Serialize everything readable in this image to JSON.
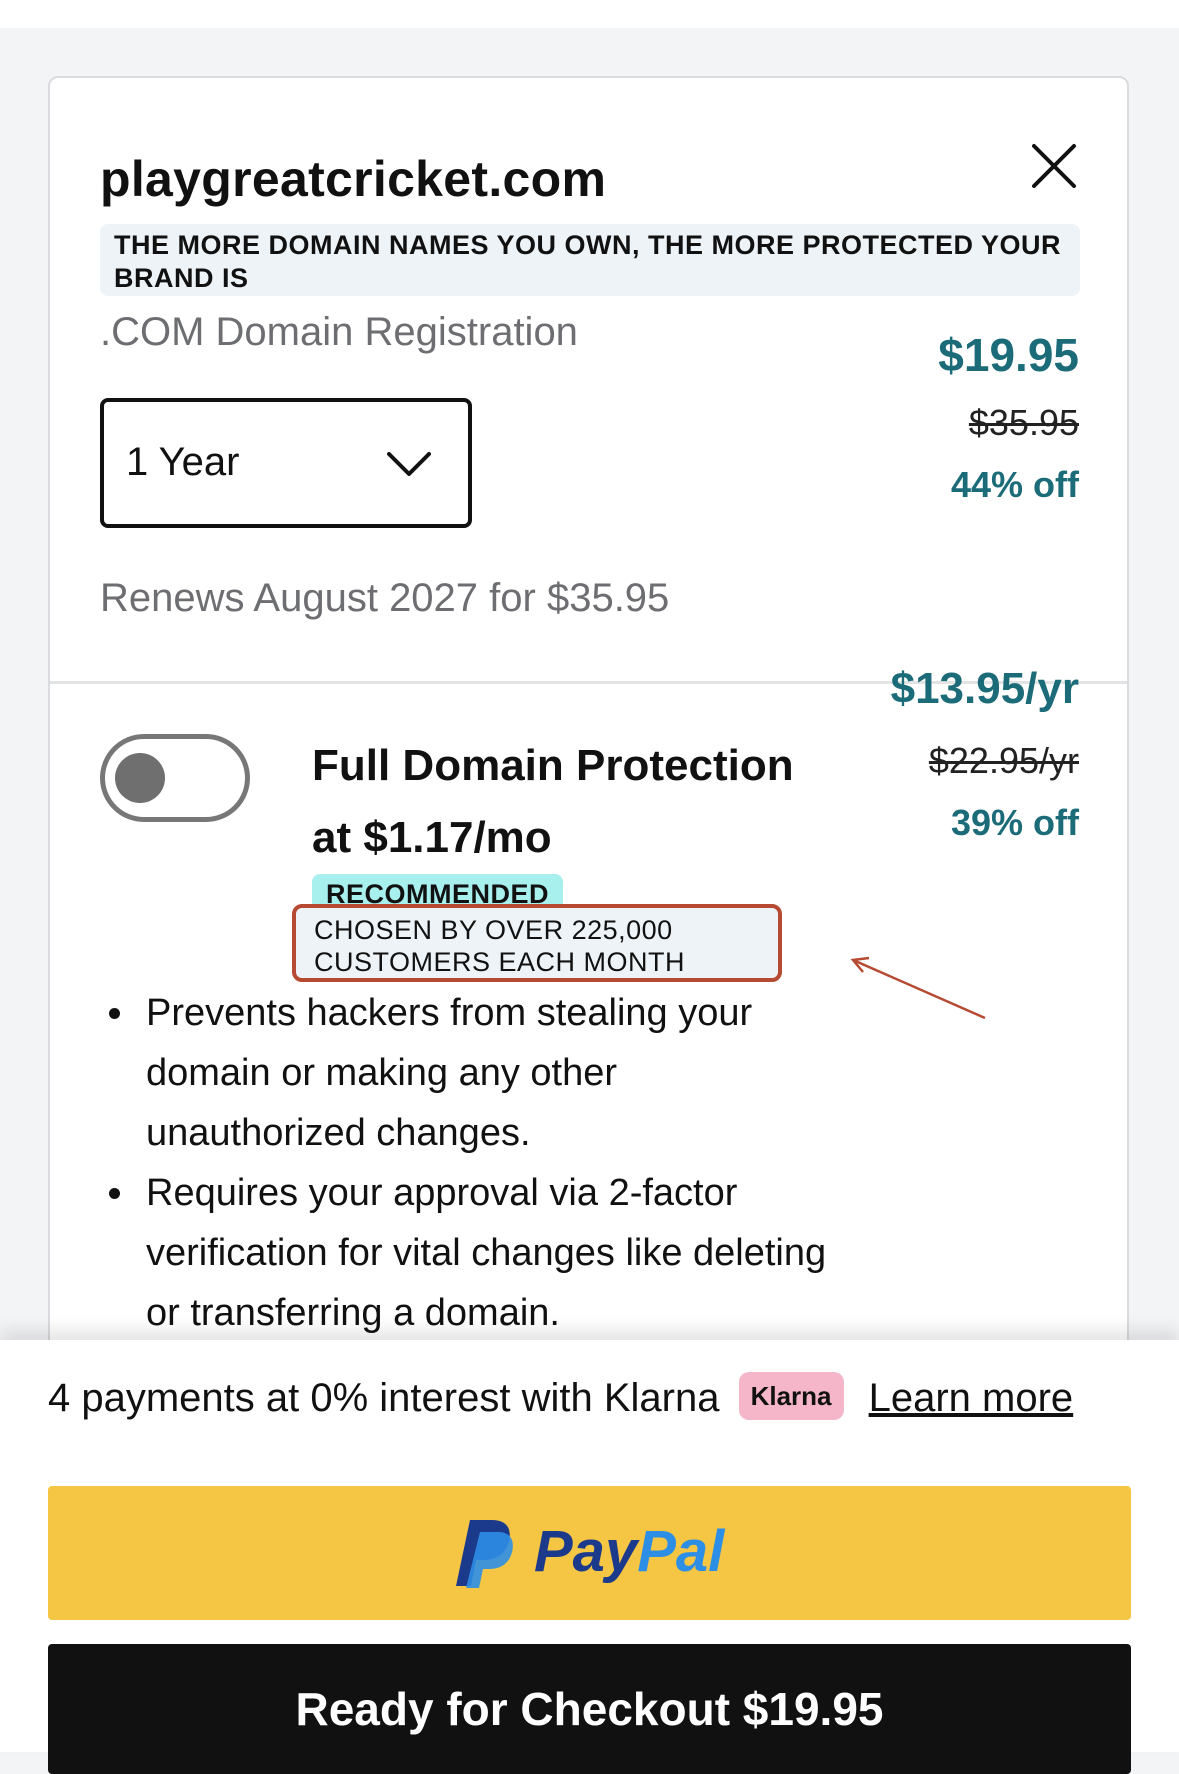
{
  "domain": {
    "name": "playgreatcricket.com",
    "promo": "THE MORE DOMAIN NAMES YOU OWN, THE MORE PROTECTED YOUR BRAND IS",
    "product_label": ".COM Domain Registration",
    "term_select": {
      "value": "1 Year",
      "options": [
        "1 Year"
      ]
    },
    "price": "$19.95",
    "original_price": "$35.95",
    "discount": "44% off",
    "renewal": "Renews August 2027 for $35.95"
  },
  "protection": {
    "toggle_on": false,
    "title_line1": "Full Domain Protection",
    "title_line2": "at $1.17/mo",
    "badge_recommended": "RECOMMENDED",
    "badge_chosen_line1": "CHOSEN BY OVER 225,000",
    "badge_chosen_line2": "CUSTOMERS EACH MONTH",
    "price": "$13.95/yr",
    "original_price": "$22.95/yr",
    "discount": "39% off",
    "bullets": [
      "Prevents hackers from stealing your domain or making any other unauthorized changes.",
      "Requires your approval via 2-factor verification for vital changes like deleting or transferring a domain."
    ]
  },
  "footer": {
    "klarna_text": "4 payments at 0% interest with Klarna",
    "klarna_badge": "Klarna",
    "learn_more": "Learn more",
    "paypal_pay": "Pay",
    "paypal_pal": "Pal",
    "checkout_label": "Ready for Checkout $19.95"
  },
  "colors": {
    "price_teal": "#1b6b78",
    "highlight_border": "#b64a32",
    "recommended_bg": "#a8f0ee",
    "paypal_yellow": "#f5c643",
    "klarna_pink": "#f4b6c8"
  },
  "icons": {
    "close": "close-icon",
    "dropdown": "chevron-down-icon",
    "paypal": "paypal-logo-icon"
  }
}
